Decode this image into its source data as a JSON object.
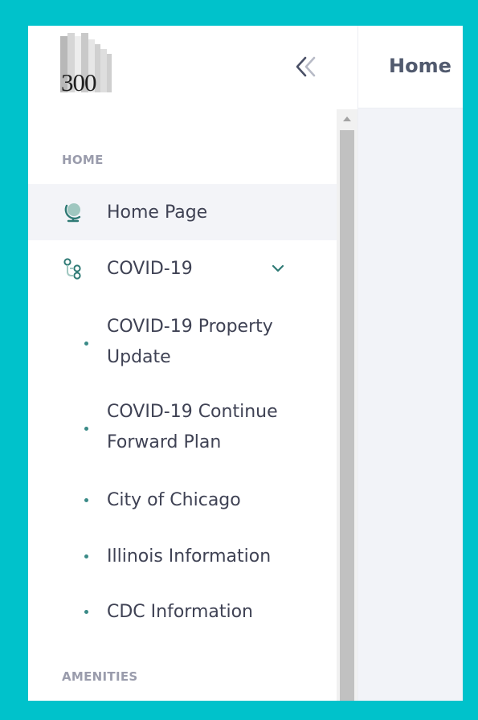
{
  "brand": {
    "logo_text": "300"
  },
  "sidebar": {
    "sections": [
      {
        "label": "HOME"
      },
      {
        "label": "AMENITIES"
      }
    ],
    "items": [
      {
        "label": "Home Page",
        "icon": "globe-icon",
        "active": true
      },
      {
        "label": "COVID-19",
        "icon": "workflow-icon",
        "expanded": true
      }
    ],
    "covid_subitems": [
      {
        "label": "COVID-19 Property Update"
      },
      {
        "label": "COVID-19 Continue Forward Plan"
      },
      {
        "label": "City of Chicago"
      },
      {
        "label": "Illinois Information"
      },
      {
        "label": "CDC Information"
      }
    ]
  },
  "header": {
    "title": "Home"
  },
  "colors": {
    "frame_background": "#00c2cb",
    "accent": "#3a8a87",
    "text": "#3f4254",
    "muted": "#9a9cac"
  }
}
